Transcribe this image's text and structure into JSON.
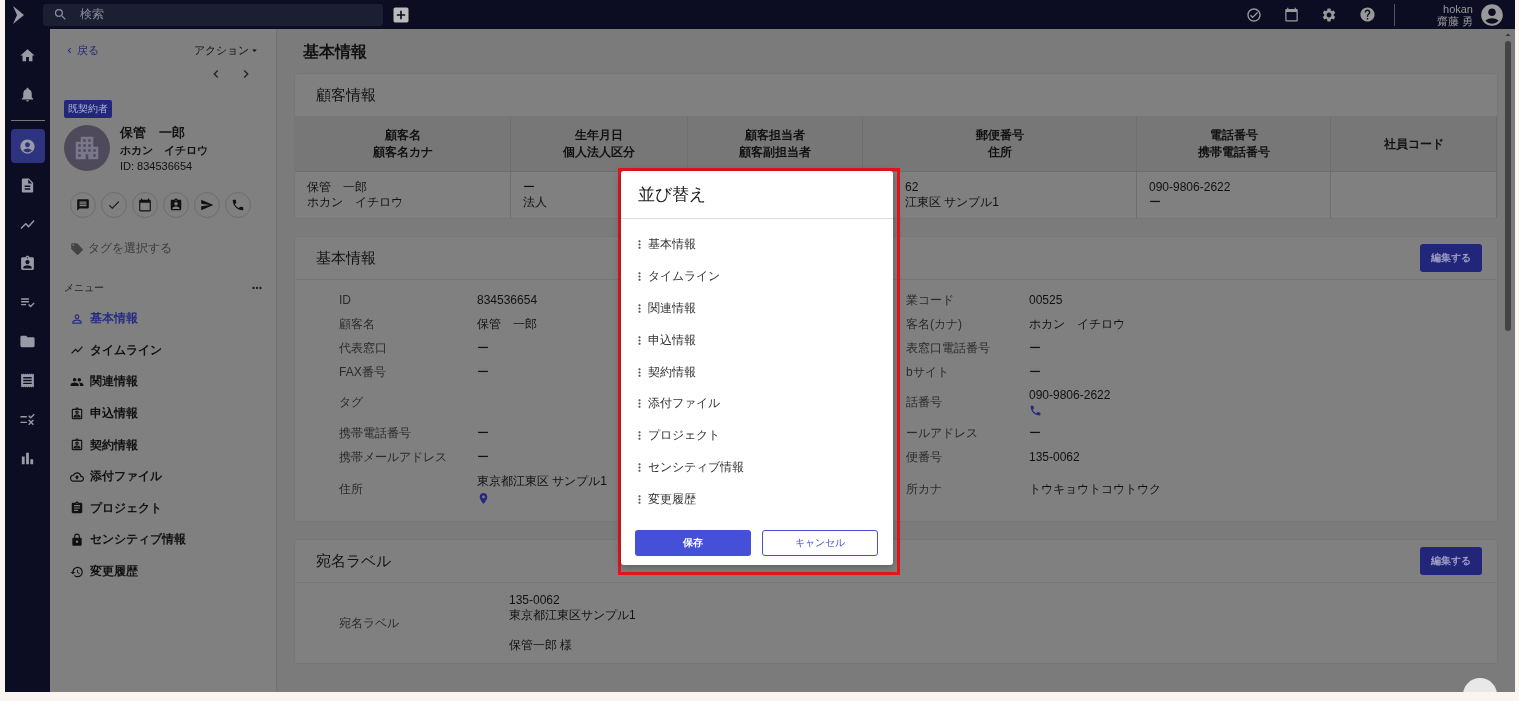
{
  "topbar": {
    "search": {
      "placeholder": "検索"
    },
    "user": {
      "name": "hokan",
      "subname": "齋藤 勇"
    }
  },
  "rail": {
    "items": [
      {
        "selected": false
      },
      {
        "selected": false
      },
      {
        "selected": true
      },
      {
        "selected": false
      },
      {
        "selected": false
      },
      {
        "selected": false
      },
      {
        "selected": false
      },
      {
        "selected": false
      },
      {
        "selected": false
      },
      {
        "selected": false
      },
      {
        "selected": false
      }
    ]
  },
  "side_panel": {
    "back": "戻る",
    "action": "アクション",
    "badge": "既契約者",
    "name": "保管　一郎",
    "kana": "ホカン　イチロウ",
    "id": "ID: 834536654",
    "tag_placeholder": "タグを選択する",
    "menu_label": "メニュー",
    "menu": [
      {
        "label": "基本情報",
        "selected": true
      },
      {
        "label": "タイムライン",
        "selected": false
      },
      {
        "label": "関連情報",
        "selected": false
      },
      {
        "label": "申込情報",
        "selected": false
      },
      {
        "label": "契約情報",
        "selected": false
      },
      {
        "label": "添付ファイル",
        "selected": false
      },
      {
        "label": "プロジェクト",
        "selected": false
      },
      {
        "label": "センシティブ情報",
        "selected": false
      },
      {
        "label": "変更履歴",
        "selected": false
      }
    ]
  },
  "page_title": "基本情報",
  "customer_card": {
    "title": "顧客情報",
    "columns": [
      {
        "title": "顧客名",
        "subtitle": "顧客名カナ"
      },
      {
        "title": "生年月日",
        "subtitle": "個人法人区分"
      },
      {
        "title": "顧客担当者",
        "subtitle": "顧客副担当者"
      },
      {
        "title": "郵便番号",
        "subtitle": "住所"
      },
      {
        "title": "電話番号",
        "subtitle": "携帯電話番号"
      },
      {
        "title": "社員コード"
      }
    ],
    "rows": [
      {
        "cells": [
          {
            "line_1": "保管　一郎",
            "line_2": "ホカン　イチロウ"
          },
          {
            "line_1": "ー",
            "line_2": "法人"
          },
          {},
          {
            "line_1": "62",
            "line_2": "江東区 サンプル1"
          },
          {
            "line_1": "090-9806-2622",
            "line_2": "ー"
          },
          {}
        ]
      }
    ]
  },
  "basic_card": {
    "title": "基本情報",
    "edit": "編集する",
    "rows": [
      {
        "left": {
          "label": "ID",
          "value": "834536654",
          "kind": "text"
        },
        "right": {
          "label": "業コード",
          "value": "00525",
          "kind": "text"
        }
      },
      {
        "left": {
          "label": "顧客名",
          "value": "保管　一郎",
          "kind": "text"
        },
        "right": {
          "label": "客名(カナ)",
          "value": "ホカン　イチロウ",
          "kind": "text"
        }
      },
      {
        "left": {
          "label": "代表窓口",
          "value": "ー",
          "kind": "text"
        },
        "right": {
          "label": "表窓口電話番号",
          "value": "ー",
          "kind": "text"
        }
      },
      {
        "left": {
          "label": "FAX番号",
          "value": "ー",
          "kind": "text"
        },
        "right": {
          "label": "bサイト",
          "value": "ー",
          "kind": "text"
        }
      },
      {
        "left": {
          "label": "タグ",
          "kind": "text"
        },
        "right": {
          "label": "話番号",
          "value": "090-9806-2622",
          "kind": "phone"
        }
      },
      {
        "left": {
          "label": "携帯電話番号",
          "value": "ー",
          "kind": "text"
        },
        "right": {
          "label": "ールアドレス",
          "value": "ー",
          "kind": "text"
        }
      },
      {
        "left": {
          "label": "携帯メールアドレス",
          "value": "ー",
          "kind": "text"
        },
        "right": {
          "label": "便番号",
          "value": "135-0062",
          "kind": "text"
        }
      },
      {
        "left": {
          "label": "住所",
          "value": "東京都江東区 サンプル1",
          "kind": "map"
        },
        "right": {
          "label": "所カナ",
          "value": "トウキョウトコウトウク",
          "kind": "text"
        }
      }
    ]
  },
  "label_card": {
    "title": "宛名ラベル",
    "edit": "編集する",
    "field": {
      "label": "宛名ラベル",
      "lines": [
        "135-0062",
        "東京都江東区サンプル1"
      ],
      "addressee": "保管一郎 様"
    }
  },
  "sort_dialog": {
    "title": "並び替え",
    "items": [
      "基本情報",
      "タイムライン",
      "関連情報",
      "申込情報",
      "契約情報",
      "添付ファイル",
      "プロジェクト",
      "センシティブ情報",
      "変更履歴"
    ],
    "save": "保存",
    "cancel": "キャンセル"
  }
}
